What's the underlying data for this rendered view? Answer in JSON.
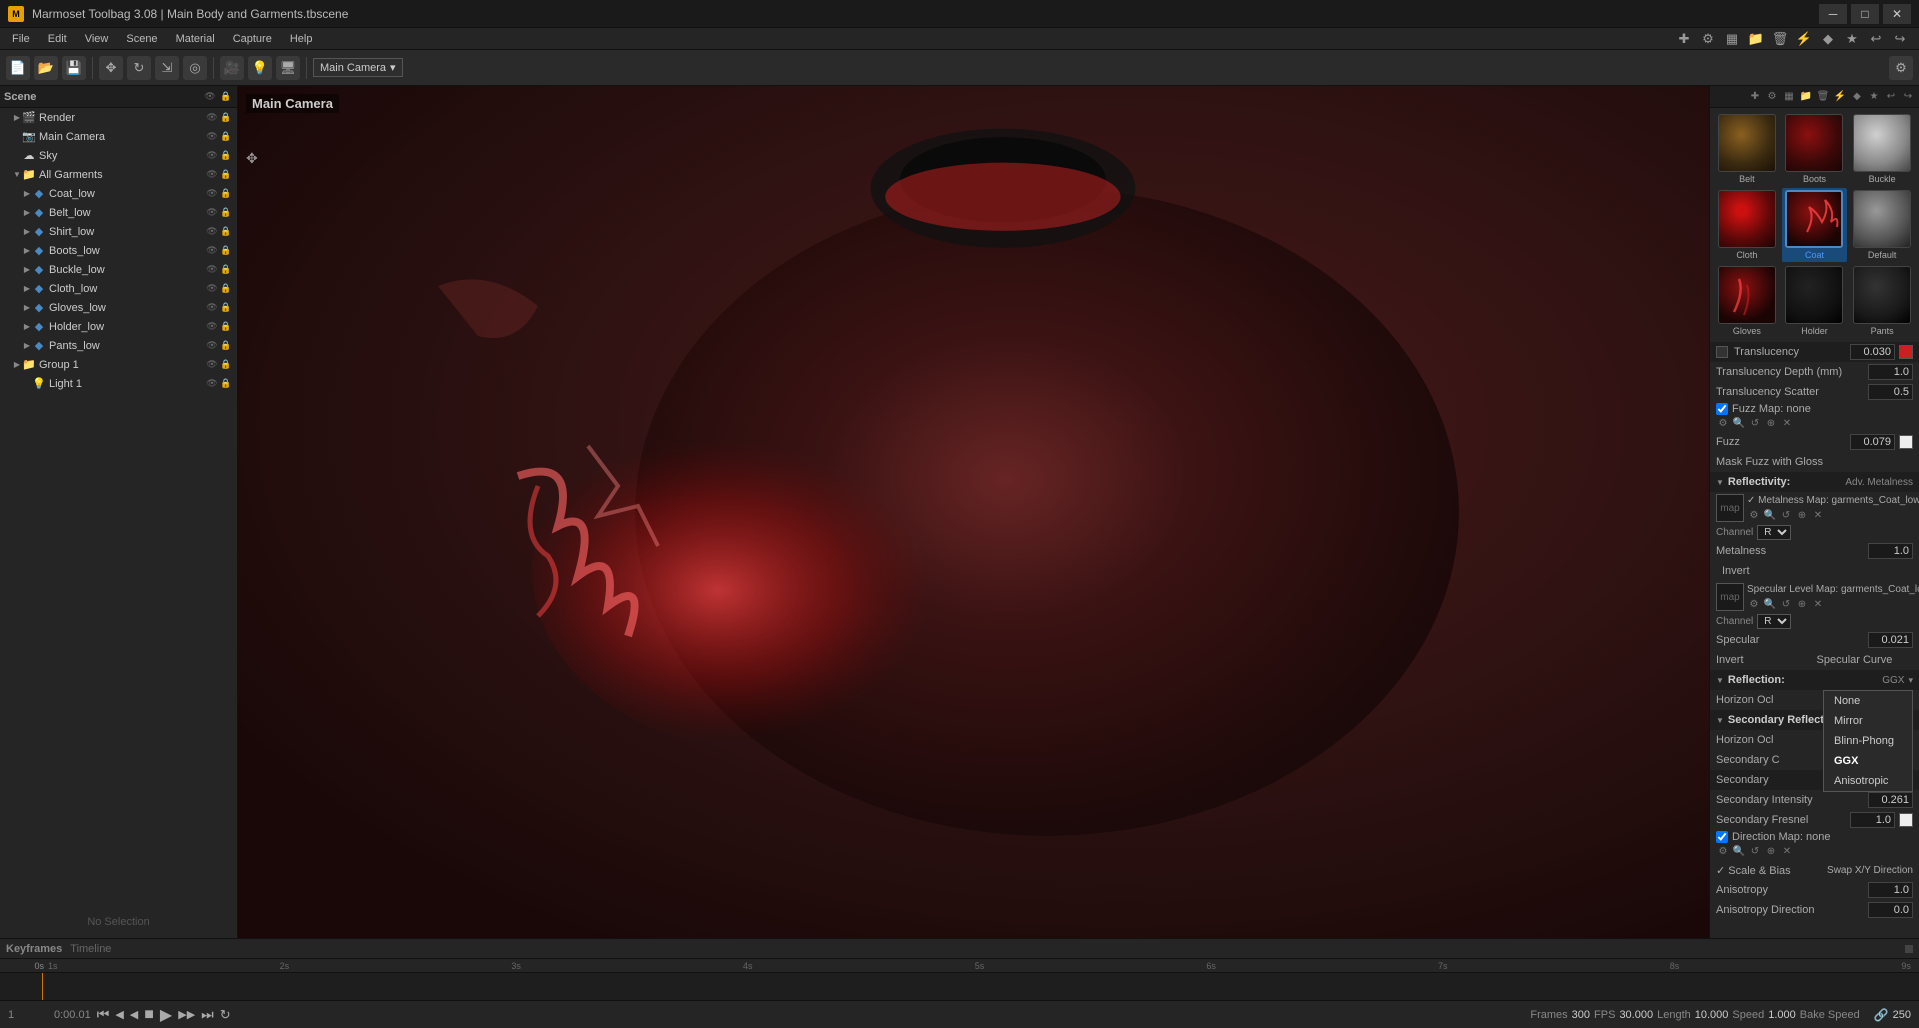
{
  "titlebar": {
    "title": "Marmoset Toolbag 3.08  |  Main Body and Garments.tbscene",
    "icon": "M",
    "min_label": "─",
    "max_label": "□",
    "close_label": "✕"
  },
  "menubar": {
    "items": [
      "File",
      "Edit",
      "View",
      "Scene",
      "Material",
      "Capture",
      "Help"
    ]
  },
  "toolbar": {
    "camera_label": "Main Camera",
    "camera_arrow": "▾"
  },
  "viewport": {
    "label": "Main Camera"
  },
  "scene_tree": {
    "header": "Scene",
    "items": [
      {
        "label": "Render",
        "icon": "🎬",
        "indent": 1,
        "arrow": "▶"
      },
      {
        "label": "Main Camera",
        "icon": "📷",
        "indent": 1,
        "arrow": ""
      },
      {
        "label": "Sky",
        "icon": "☁",
        "indent": 1,
        "arrow": ""
      },
      {
        "label": "All Garments",
        "icon": "📁",
        "indent": 1,
        "arrow": "▼"
      },
      {
        "label": "Coat_low",
        "icon": "🔷",
        "indent": 2,
        "arrow": "▶"
      },
      {
        "label": "Belt_low",
        "icon": "🔷",
        "indent": 2,
        "arrow": "▶"
      },
      {
        "label": "Shirt_low",
        "icon": "🔷",
        "indent": 2,
        "arrow": "▶"
      },
      {
        "label": "Boots_low",
        "icon": "🔷",
        "indent": 2,
        "arrow": "▶"
      },
      {
        "label": "Buckle_low",
        "icon": "🔷",
        "indent": 2,
        "arrow": "▶"
      },
      {
        "label": "Cloth_low",
        "icon": "🔷",
        "indent": 2,
        "arrow": "▶"
      },
      {
        "label": "Gloves_low",
        "icon": "🔷",
        "indent": 2,
        "arrow": "▶"
      },
      {
        "label": "Holder_low",
        "icon": "🔷",
        "indent": 2,
        "arrow": "▶"
      },
      {
        "label": "Pants_low",
        "icon": "🔷",
        "indent": 2,
        "arrow": "▶"
      },
      {
        "label": "Group 1",
        "icon": "📁",
        "indent": 1,
        "arrow": "▶"
      },
      {
        "label": "Light 1",
        "icon": "💡",
        "indent": 2,
        "arrow": ""
      }
    ]
  },
  "no_selection": "No Selection",
  "materials": {
    "items": [
      {
        "id": "belt",
        "label": "Belt",
        "thumb_class": "thumb-belt"
      },
      {
        "id": "boots",
        "label": "Boots",
        "thumb_class": "thumb-boots"
      },
      {
        "id": "buckle",
        "label": "Buckle",
        "thumb_class": "thumb-buckle"
      },
      {
        "id": "cloth",
        "label": "Cloth",
        "thumb_class": "thumb-cloth"
      },
      {
        "id": "coat",
        "label": "Coat",
        "thumb_class": "thumb-coat",
        "selected": true
      },
      {
        "id": "default",
        "label": "Default",
        "thumb_class": "thumb-default"
      },
      {
        "id": "gloves",
        "label": "Gloves",
        "thumb_class": "thumb-gloves"
      },
      {
        "id": "holder",
        "label": "Holder",
        "thumb_class": "thumb-holder"
      },
      {
        "id": "pants",
        "label": "Pants",
        "thumb_class": "thumb-pants"
      }
    ]
  },
  "properties": {
    "translucency_section": {
      "label": "Translucency",
      "value": "0.030",
      "depth_label": "Translucency Depth (mm)",
      "depth_value": "1.0",
      "scatter_label": "Translucency Scatter",
      "scatter_value": "0.5"
    },
    "fuzz_section": {
      "checkbox_label": "Fuzz Map:",
      "map_value": "none",
      "fuzz_label": "Fuzz",
      "fuzz_value": "0.079",
      "mask_label": "Mask Fuzz with Gloss"
    },
    "reflectivity_section": {
      "label": "Reflectivity:",
      "extra": "Adv. Metalness",
      "metalness_map_label": "Metalness Map:",
      "metalness_map_value": "garments_Coat_low_Sp",
      "channel_label": "Channel",
      "channel_value": "R",
      "metalness_label": "Metalness",
      "metalness_value": "1.0",
      "invert_label": "Invert",
      "specular_map_label": "Specular Level Map:",
      "specular_map_value": "garments_Coat_low",
      "specular_channel_label": "Channel",
      "specular_channel_value": "R",
      "specular_label": "Specular",
      "specular_value": "0.021",
      "invert2_label": "Invert",
      "specular_curve_label": "Specular Curve"
    },
    "reflection_section": {
      "label": "Reflection:",
      "extra": "GGX",
      "horizon_occ_label": "Horizon Ocl",
      "sub_header": "Secondary Reflection:",
      "horizon_occ2_label": "Horizon Ocl",
      "secondary_color_label": "Secondary C"
    },
    "secondary_reflection": {
      "secondary_label": "Secondary",
      "secondary_intensity_label": "Secondary Intensity",
      "secondary_intensity_value": "0.261",
      "secondary_fresnel_label": "Secondary Fresnel",
      "secondary_fresnel_value": "1.0",
      "direction_map_label": "✓ Direction Map:",
      "direction_map_value": "none"
    },
    "scale_bias": {
      "label": "✓ Scale & Bias",
      "swap_label": "Swap X/Y Direction",
      "anisotropy_label": "Anisotropy",
      "anisotropy_value": "1.0",
      "anisotropy_dir_label": "Anisotropy Direction",
      "anisotropy_dir_value": "0.0"
    },
    "reflection_dropdown": {
      "items": [
        "None",
        "Mirror",
        "Blinn-Phong",
        "GGX",
        "Anisotropic"
      ],
      "active": "GGX"
    }
  },
  "timeline": {
    "keyframes_label": "Keyframes",
    "timeline_label": "Timeline",
    "current_time": "0:00.01",
    "ruler_marks": [
      "0s",
      "1s",
      "2s",
      "3s",
      "4s",
      "5s",
      "6s",
      "7s",
      "8s",
      "9s"
    ],
    "frames_label": "Frames",
    "frames_value": "300",
    "fps_label": "FPS",
    "fps_value": "30.000",
    "length_label": "Length",
    "length_value": "10.000",
    "speed_label": "Speed",
    "speed_value": "1.000",
    "bake_speed_label": "Bake Speed"
  },
  "icons": {
    "settings": "⚙",
    "search": "🔍",
    "refresh": "↺",
    "copy": "⊕",
    "close": "✕",
    "arrow_down": "▾",
    "arrow_right": "▶",
    "triangle_down": "▼",
    "check": "✓",
    "play": "▶",
    "pause": "⏸",
    "stop": "⏹",
    "prev": "⏮",
    "next": "⏭",
    "loop": "↻",
    "camera_rec": "⏺"
  }
}
